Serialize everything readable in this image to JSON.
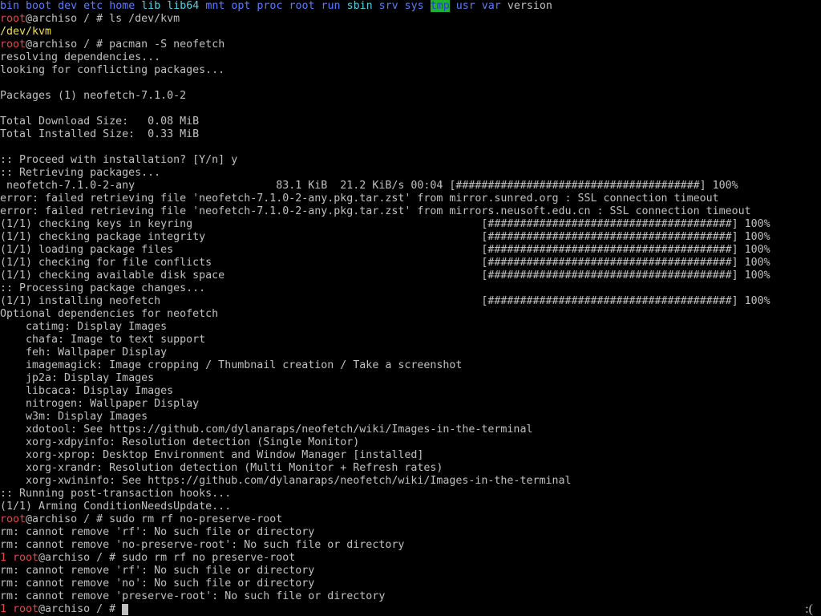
{
  "terminal": {
    "status_indicator": ":(",
    "lines": [
      [
        [
          "blue",
          "bin"
        ],
        [
          "default",
          " "
        ],
        [
          "blue",
          "boot"
        ],
        [
          "default",
          " "
        ],
        [
          "blue",
          "dev"
        ],
        [
          "default",
          " "
        ],
        [
          "blue",
          "etc"
        ],
        [
          "default",
          " "
        ],
        [
          "blue",
          "home"
        ],
        [
          "default",
          " "
        ],
        [
          "cyan",
          "lib"
        ],
        [
          "default",
          " "
        ],
        [
          "cyan",
          "lib64"
        ],
        [
          "default",
          " "
        ],
        [
          "blue",
          "mnt"
        ],
        [
          "default",
          " "
        ],
        [
          "blue",
          "opt"
        ],
        [
          "default",
          " "
        ],
        [
          "blue",
          "proc"
        ],
        [
          "default",
          " "
        ],
        [
          "blue",
          "root"
        ],
        [
          "default",
          " "
        ],
        [
          "blue",
          "run"
        ],
        [
          "default",
          " "
        ],
        [
          "cyan",
          "sbin"
        ],
        [
          "default",
          " "
        ],
        [
          "blue",
          "srv"
        ],
        [
          "default",
          " "
        ],
        [
          "blue",
          "sys"
        ],
        [
          "default",
          " "
        ],
        [
          "tmp",
          "tmp"
        ],
        [
          "default",
          " "
        ],
        [
          "blue",
          "usr"
        ],
        [
          "default",
          " "
        ],
        [
          "blue",
          "var"
        ],
        [
          "default",
          " version"
        ]
      ],
      [
        [
          "red",
          "root"
        ],
        [
          "default",
          "@archiso / # ls /dev/kvm"
        ]
      ],
      [
        [
          "yellow",
          "/dev/kvm"
        ]
      ],
      [
        [
          "red",
          "root"
        ],
        [
          "default",
          "@archiso / # pacman -S neofetch"
        ]
      ],
      [
        [
          "default",
          "resolving dependencies..."
        ]
      ],
      [
        [
          "default",
          "looking for conflicting packages..."
        ]
      ],
      [
        [
          "default",
          ""
        ]
      ],
      [
        [
          "default",
          "Packages (1) neofetch-7.1.0-2"
        ]
      ],
      [
        [
          "default",
          ""
        ]
      ],
      [
        [
          "default",
          "Total Download Size:   0.08 MiB"
        ]
      ],
      [
        [
          "default",
          "Total Installed Size:  0.33 MiB"
        ]
      ],
      [
        [
          "default",
          ""
        ]
      ],
      [
        [
          "default",
          ":: Proceed with installation? [Y/n] y"
        ]
      ],
      [
        [
          "default",
          ":: Retrieving packages..."
        ]
      ],
      [
        [
          "default",
          " neofetch-7.1.0-2-any                      83.1 KiB  21.2 KiB/s 00:04 [######################################] 100%"
        ]
      ],
      [
        [
          "default",
          "error: failed retrieving file 'neofetch-7.1.0-2-any.pkg.tar.zst' from mirror.sunred.org : SSL connection timeout"
        ]
      ],
      [
        [
          "default",
          "error: failed retrieving file 'neofetch-7.1.0-2-any.pkg.tar.zst' from mirrors.neusoft.edu.cn : SSL connection timeout"
        ]
      ],
      [
        [
          "default",
          "(1/1) checking keys in keyring                                             [######################################] 100%"
        ]
      ],
      [
        [
          "default",
          "(1/1) checking package integrity                                           [######################################] 100%"
        ]
      ],
      [
        [
          "default",
          "(1/1) loading package files                                                [######################################] 100%"
        ]
      ],
      [
        [
          "default",
          "(1/1) checking for file conflicts                                          [######################################] 100%"
        ]
      ],
      [
        [
          "default",
          "(1/1) checking available disk space                                        [######################################] 100%"
        ]
      ],
      [
        [
          "default",
          ":: Processing package changes..."
        ]
      ],
      [
        [
          "default",
          "(1/1) installing neofetch                                                  [######################################] 100%"
        ]
      ],
      [
        [
          "default",
          "Optional dependencies for neofetch"
        ]
      ],
      [
        [
          "default",
          "    catimg: Display Images"
        ]
      ],
      [
        [
          "default",
          "    chafa: Image to text support"
        ]
      ],
      [
        [
          "default",
          "    feh: Wallpaper Display"
        ]
      ],
      [
        [
          "default",
          "    imagemagick: Image cropping / Thumbnail creation / Take a screenshot"
        ]
      ],
      [
        [
          "default",
          "    jp2a: Display Images"
        ]
      ],
      [
        [
          "default",
          "    libcaca: Display Images"
        ]
      ],
      [
        [
          "default",
          "    nitrogen: Wallpaper Display"
        ]
      ],
      [
        [
          "default",
          "    w3m: Display Images"
        ]
      ],
      [
        [
          "default",
          "    xdotool: See https://github.com/dylanaraps/neofetch/wiki/Images-in-the-terminal"
        ]
      ],
      [
        [
          "default",
          "    xorg-xdpyinfo: Resolution detection (Single Monitor)"
        ]
      ],
      [
        [
          "default",
          "    xorg-xprop: Desktop Environment and Window Manager [installed]"
        ]
      ],
      [
        [
          "default",
          "    xorg-xrandr: Resolution detection (Multi Monitor + Refresh rates)"
        ]
      ],
      [
        [
          "default",
          "    xorg-xwininfo: See https://github.com/dylanaraps/neofetch/wiki/Images-in-the-terminal"
        ]
      ],
      [
        [
          "default",
          ":: Running post-transaction hooks..."
        ]
      ],
      [
        [
          "default",
          "(1/1) Arming ConditionNeedsUpdate..."
        ]
      ],
      [
        [
          "red",
          "root"
        ],
        [
          "default",
          "@archiso / # sudo rm rf no-preserve-root"
        ]
      ],
      [
        [
          "default",
          "rm: cannot remove 'rf': No such file or directory"
        ]
      ],
      [
        [
          "default",
          "rm: cannot remove 'no-preserve-root': No such file or directory"
        ]
      ],
      [
        [
          "red",
          "1 root"
        ],
        [
          "default",
          "@archiso / # sudo rm rf no preserve-root"
        ]
      ],
      [
        [
          "default",
          "rm: cannot remove 'rf': No such file or directory"
        ]
      ],
      [
        [
          "default",
          "rm: cannot remove 'no': No such file or directory"
        ]
      ],
      [
        [
          "default",
          "rm: cannot remove 'preserve-root': No such file or directory"
        ]
      ],
      [
        [
          "red",
          "1 root"
        ],
        [
          "default",
          "@archiso / # "
        ]
      ]
    ]
  }
}
